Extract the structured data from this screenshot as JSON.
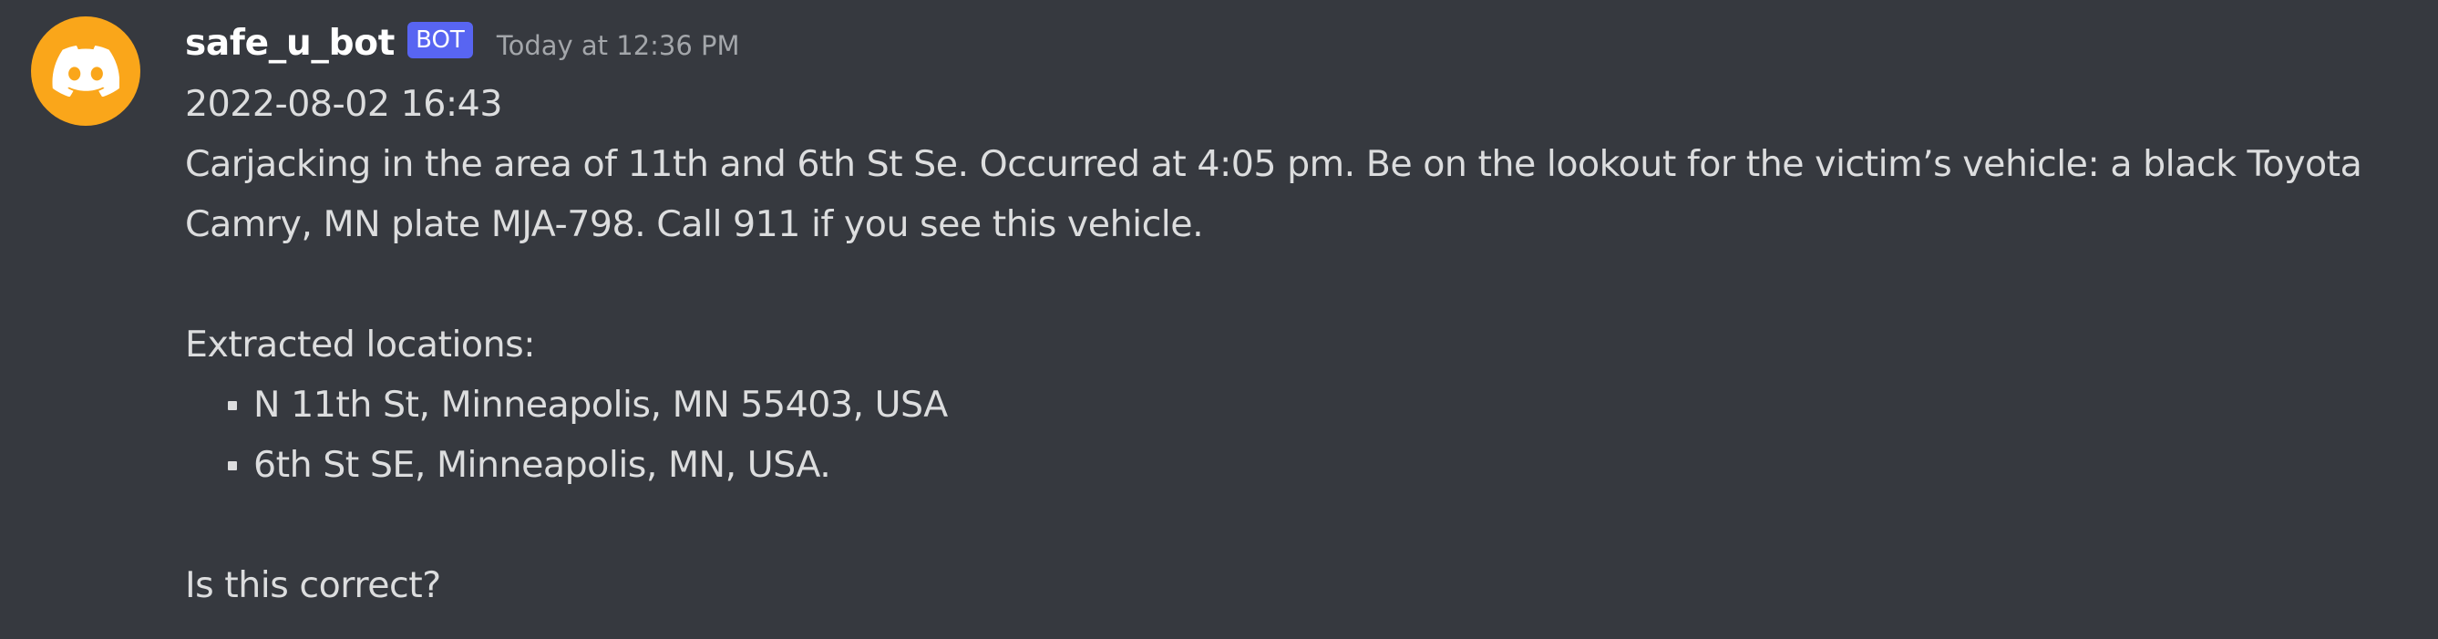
{
  "message": {
    "author": "safe_u_bot",
    "bot_tag": "BOT",
    "timestamp": "Today at 12:36 PM",
    "avatar_icon": "discord-logo-icon",
    "avatar_color": "#faa61a",
    "lines": {
      "date": "2022-08-02 16:43",
      "report_line_1": "Carjacking in the area of 11th and 6th St Se. Occurred at 4:05 pm. Be on the lookout for the victim’s vehicle: a black Toyota",
      "report_line_2": "Camry, MN plate MJA-798. Call 911 if you see this vehicle.",
      "locations_heading": "Extracted locations:",
      "question": "Is this correct?"
    },
    "locations": [
      "N 11th St, Minneapolis, MN 55403, USA",
      "6th St SE, Minneapolis, MN, USA."
    ]
  },
  "colors": {
    "background": "#36393f",
    "bot_tag": "#5865f2",
    "text": "#dcddde",
    "username": "#ffffff",
    "timestamp": "#a3a6aa"
  }
}
